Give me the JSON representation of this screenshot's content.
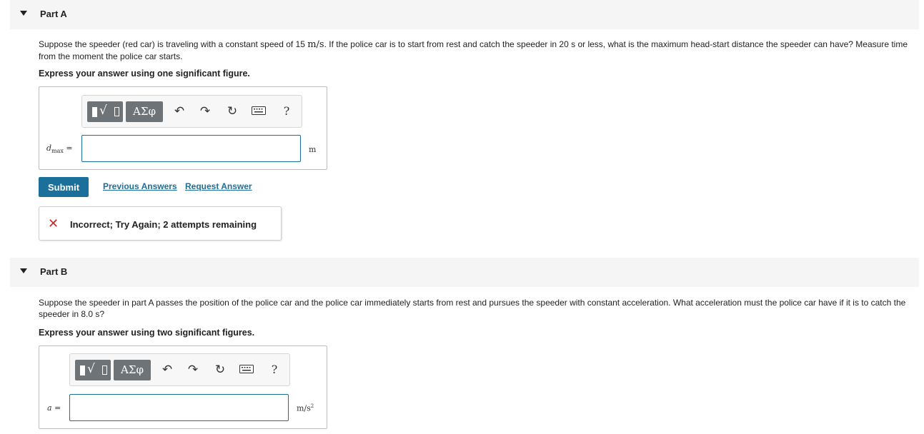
{
  "partA": {
    "title": "Part A",
    "question_pre": "Suppose the speeder (red car) is traveling with a constant speed of 15 ",
    "question_unit": "m/s",
    "question_post": ". If the police car is to start from rest and catch the speeder in 20 s or less, what is the maximum head-start distance the speeder can have? Measure time from the moment the police car starts.",
    "instruction": "Express your answer using one significant figure.",
    "var_symbol": "d",
    "var_sub": "max",
    "equals": "=",
    "input_value": "",
    "unit": "m",
    "submit_label": "Submit",
    "previous_answers_label": "Previous Answers",
    "request_answer_label": "Request Answer",
    "feedback_icon": "✕",
    "feedback_text": "Incorrect; Try Again; 2 attempts remaining"
  },
  "partB": {
    "title": "Part B",
    "question": "Suppose the speeder in part A passes the position of the police car and the police car immediately starts from rest and pursues the speeder with constant acceleration. What acceleration must the police car have if it is to catch the speeder in 8.0 s?",
    "instruction": "Express your answer using two significant figures.",
    "var_symbol": "a",
    "equals": "=",
    "input_value": "",
    "unit_base": "m/s",
    "unit_exp": "2"
  },
  "toolbar": {
    "greek_label": "ΑΣφ",
    "help_label": "?",
    "icons": [
      "templates-icon",
      "greek-letters-icon",
      "undo-icon",
      "redo-icon",
      "reset-icon",
      "keyboard-icon",
      "help-icon"
    ]
  },
  "colors": {
    "accent": "#1a6f9b",
    "error": "#e0201b",
    "header_bg": "#f5f5f5",
    "toolbar_btn": "#6e7378"
  }
}
